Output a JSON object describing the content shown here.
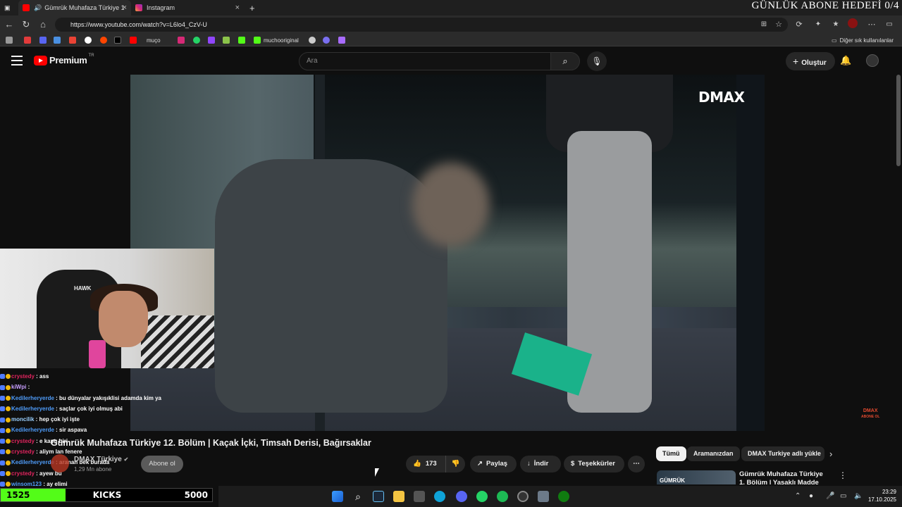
{
  "browser": {
    "tabs": [
      {
        "title": "Gümrük Muhafaza Türkiye 1",
        "active": true
      },
      {
        "title": "Instagram",
        "active": false
      }
    ],
    "url": "https://www.youtube.com/watch?v=L6lo4_CzV-U",
    "bookmarks": [
      "muço",
      "muchooriginal"
    ],
    "bookmarks_other": "Diğer sık kullanılanlar"
  },
  "overlay": {
    "goal_heading": "GÜNLÜK ABONE HEDEFİ 0/4",
    "follower_goal": {
      "current": "1525",
      "label": "KICKS",
      "target": "5000",
      "progress": 0.305
    }
  },
  "youtube": {
    "brand": "Premium",
    "region": "TR",
    "search_placeholder": "Ara",
    "create_label": "Oluştur",
    "video": {
      "watermark": "DMAX",
      "watermark_sub_1": "DMAX",
      "watermark_sub_2": "ABONE OL",
      "title": "Gümrük Muhafaza Türkiye 12. Bölüm | Kaçak İçki, Timsah Derisi, Bağırsaklar",
      "channel": "DMAX Türkiye",
      "subscribers": "1,29 Mn abone",
      "subscribe_label": "Abone ol",
      "likes": "173",
      "share_label": "Paylaş",
      "download_label": "İndir",
      "thanks_label": "Teşekkürler"
    },
    "chips": [
      "Tümü",
      "Aramanızdan",
      "DMAX Turkiye adlı yükle"
    ],
    "recommended": {
      "thumb_text": "GÜMRÜK",
      "title": "Gümrük Muhafaza Türkiye 1. Bölüm | Yasaklı Madde"
    }
  },
  "chat": [
    {
      "user": "crystedy",
      "msg": "ass",
      "color": "#e0245e"
    },
    {
      "user": "kiWpi",
      "msg": "",
      "color": "#c9a0ff"
    },
    {
      "user": "Kedilerheryerde",
      "msg": "bu dünyalar yakışıklisi adamda kim ya",
      "color": "#4f9cf9"
    },
    {
      "user": "Kedilerheryerde",
      "msg": "saçlar çok iyi olmuş abi",
      "color": "#4f9cf9"
    },
    {
      "user": "moncilik",
      "msg": "hep çok iyi işte",
      "color": "#9ad0ff"
    },
    {
      "user": "Kedilerheryerde",
      "msg": "sir aspava",
      "color": "#4f9cf9"
    },
    {
      "user": "crystedy",
      "msg": "e kaptı biri",
      "color": "#e0245e"
    },
    {
      "user": "crystedy",
      "msg": "aliym lan fenere",
      "color": "#e0245e"
    },
    {
      "user": "Kedilerheryerde",
      "msg": "aranan bek burada",
      "color": "#4f9cf9"
    },
    {
      "user": "crystedy",
      "msg": "ayew bu",
      "color": "#e0245e"
    },
    {
      "user": "winsom123",
      "msg": "ay elimi",
      "color": "#4f9cf9"
    }
  ],
  "system": {
    "time": "23:29",
    "date": "17.10.2025"
  },
  "colors": {
    "kick_green": "#53fc18",
    "youtube_red": "#ff0000"
  }
}
